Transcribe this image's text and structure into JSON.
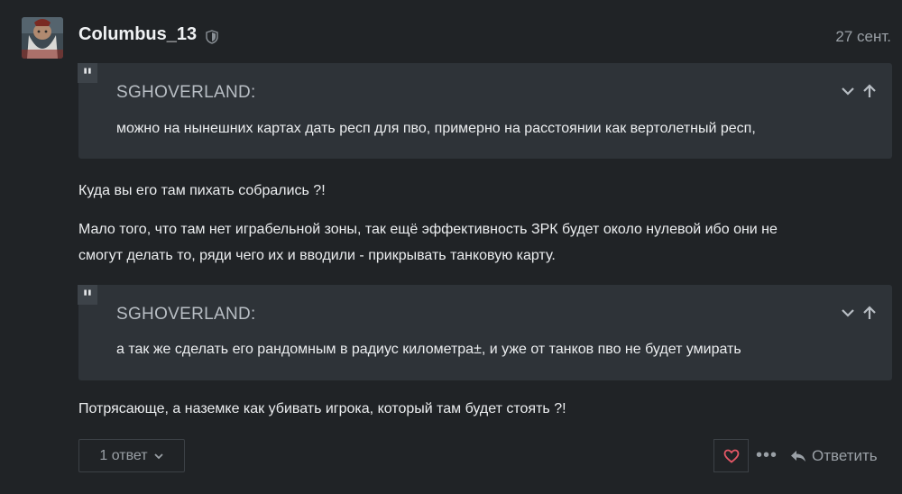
{
  "post": {
    "username": "Columbus_13",
    "date": "27 сент.",
    "quotes": [
      {
        "author": "SGHOVERLAND:",
        "text": "можно на нынешних картах дать респ для пво, примерно на расстоянии как вертолетный респ,"
      },
      {
        "author": "SGHOVERLAND:",
        "text": "а так же сделать его рандомным в радиус километра±, и уже от танков пво не будет умирать"
      }
    ],
    "paragraphs": [
      "Куда вы его там пихать собрались ?!",
      "Мало того, что там нет играбельной зоны, так ещё эффективность ЗРК будет около нулевой ибо они не",
      "смогут делать то, ряди чего их и вводили - прикрывать танковую карту.",
      "Потрясающе, а наземке как убивать игрока, который там будет стоять ?!"
    ]
  },
  "footer": {
    "replies_label": "1 ответ",
    "reply_label": "Ответить",
    "more_label": "•••"
  },
  "icons": {
    "badge": "shield-icon",
    "quote": "quote-icon",
    "expand": "chevron-down-icon",
    "collapse": "arrow-up-icon",
    "like": "heart-icon",
    "more": "ellipsis-icon",
    "reply": "reply-icon"
  },
  "colors": {
    "background": "#202326",
    "quote_background": "#2e3338",
    "text": "#eceef0",
    "muted": "#9aa0a6",
    "like": "#e45766"
  }
}
